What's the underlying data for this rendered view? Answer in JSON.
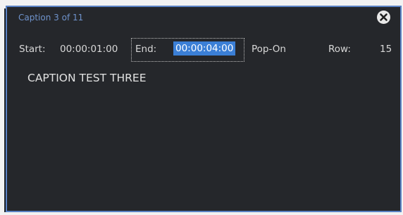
{
  "window": {
    "title": "Caption 3 of 11"
  },
  "fields": {
    "start_label": "Start:",
    "start_value": "00:00:01:00",
    "end_label": "End:",
    "end_value": "00:00:04:00",
    "mode": "Pop-On",
    "row_label": "Row:",
    "row_value": "15"
  },
  "caption": {
    "text": "CAPTION TEST THREE"
  },
  "icons": {
    "close": "close-icon"
  },
  "colors": {
    "border_accent": "#5a82c4",
    "title_text": "#6f93cc",
    "selection": "#3b7fd6",
    "background": "#25272b"
  }
}
